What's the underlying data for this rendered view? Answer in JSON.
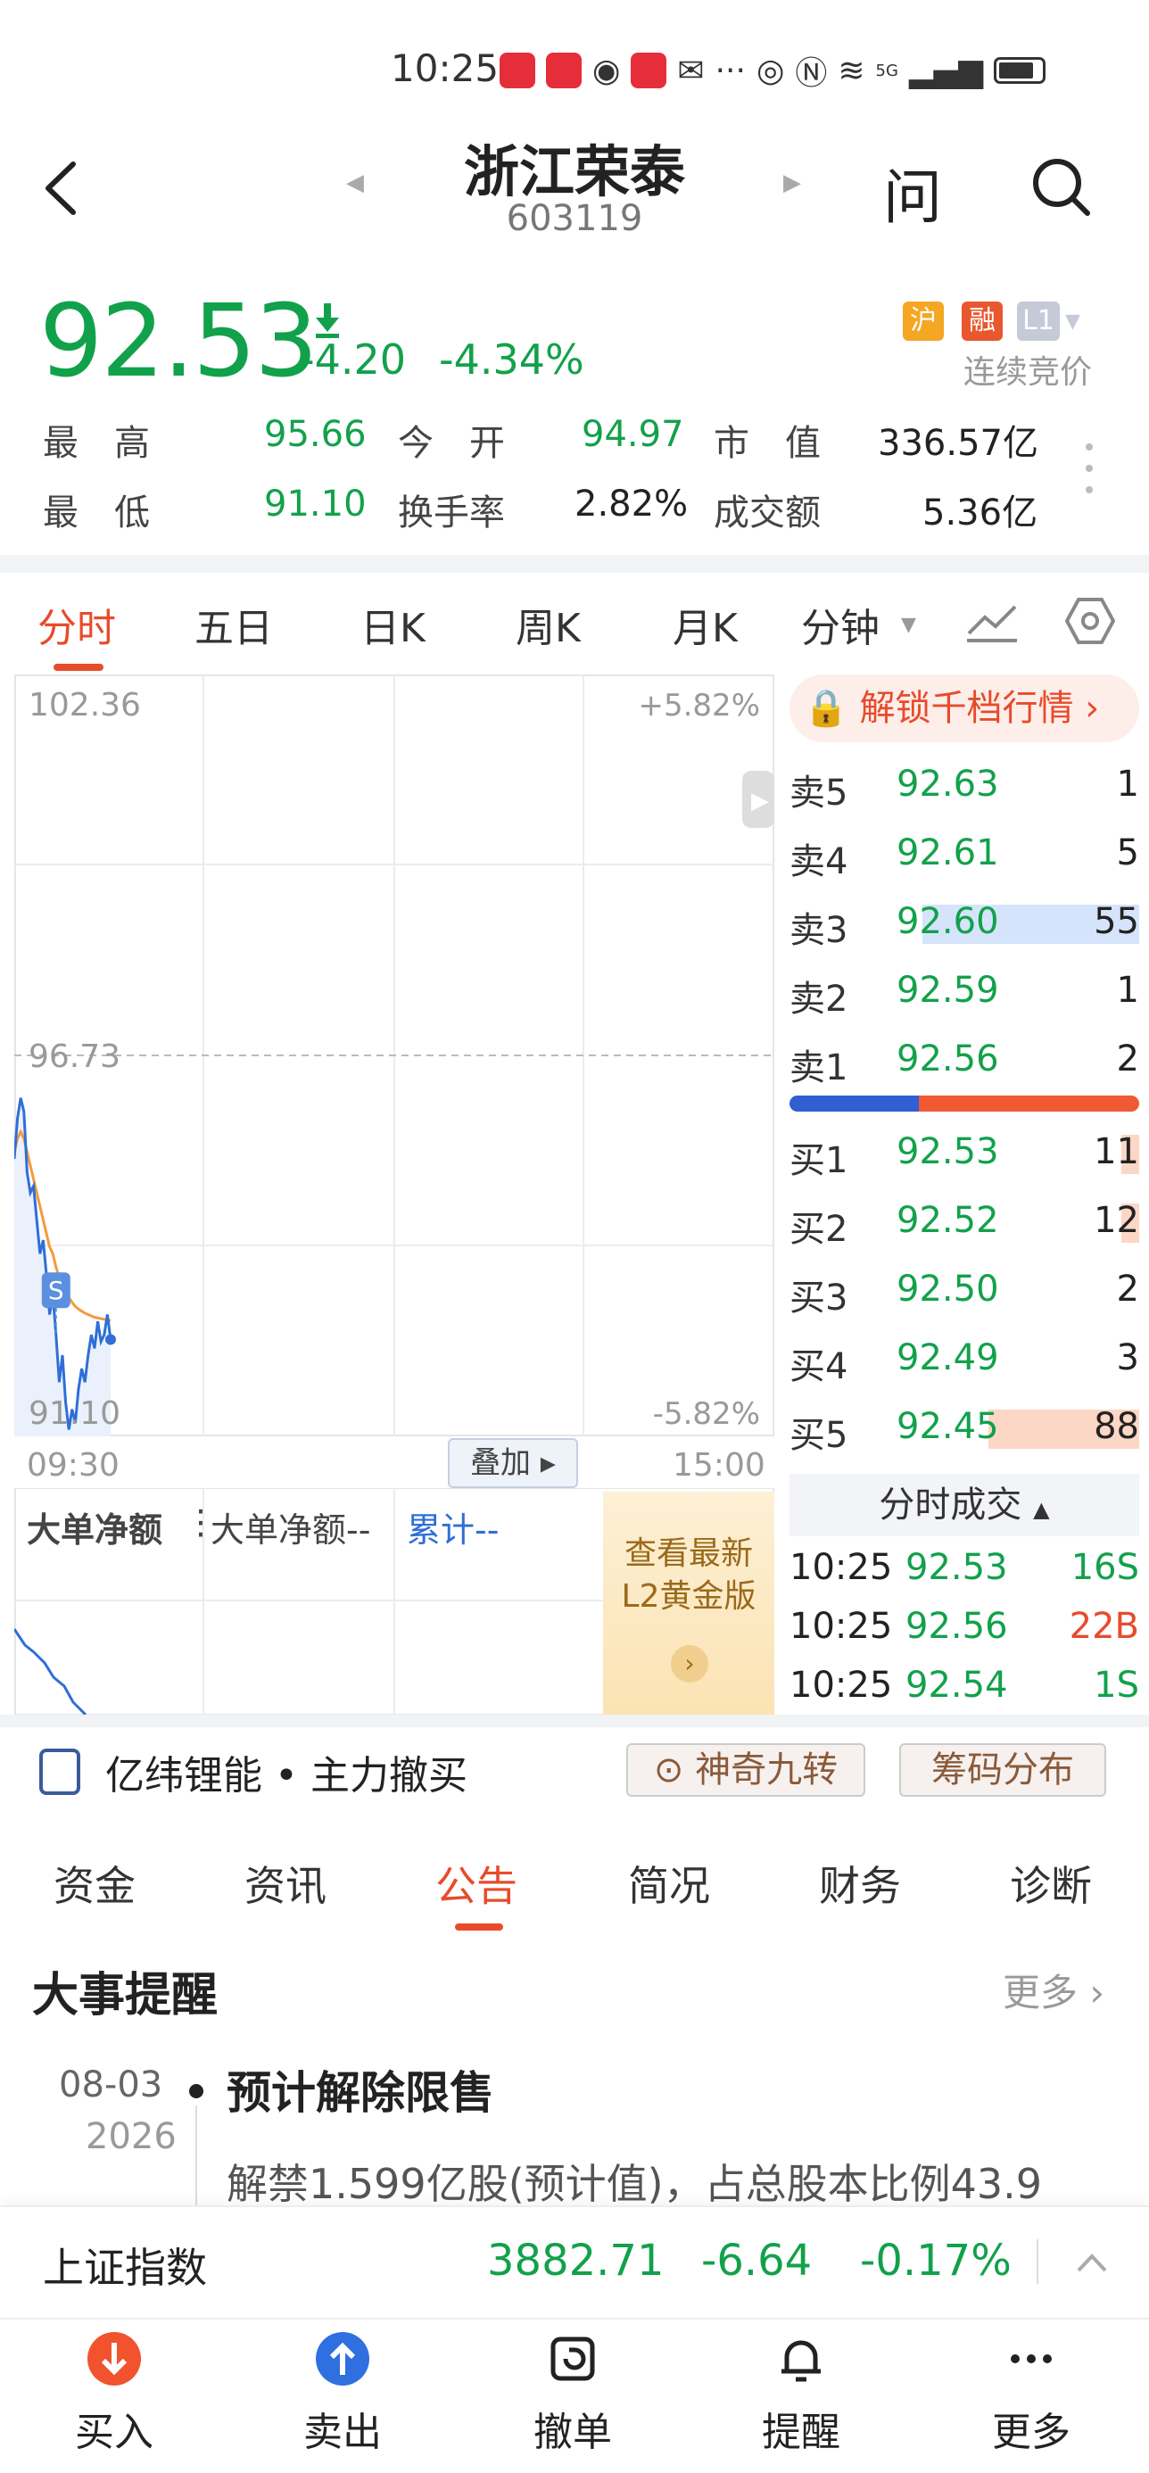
{
  "status_bar": {
    "time": "10:25",
    "network": "5G",
    "extra_dots": "···"
  },
  "header": {
    "title": "浙江荣泰",
    "code": "603119",
    "ask_label": "问"
  },
  "quote": {
    "price": "92.53",
    "change": "-4.20",
    "change_pct": "-4.34%",
    "badges": [
      "沪",
      "融",
      "L1"
    ],
    "auction_label": "连续竞价",
    "stats": [
      {
        "label": "最　高",
        "value": "95.66"
      },
      {
        "label": "今　开",
        "value": "94.97"
      },
      {
        "label": "市　值",
        "value": "336.57亿"
      },
      {
        "label": "最　低",
        "value": "91.10"
      },
      {
        "label": "换手率",
        "value": "2.82%"
      },
      {
        "label": "成交额",
        "value": "5.36亿"
      }
    ]
  },
  "period_tabs": [
    "分时",
    "五日",
    "日K",
    "周K",
    "月K",
    "分钟"
  ],
  "chart_data": {
    "type": "line",
    "y_top": "102.36",
    "y_mid": "96.73",
    "y_bottom": "91.10",
    "pct_top": "+5.82%",
    "pct_bottom": "-5.82%",
    "x_start": "09:30",
    "x_end": "15:00",
    "overlay_label": "叠加",
    "signal_marker": "S",
    "ylim": [
      91.1,
      102.36
    ],
    "price": [
      95.2,
      95.8,
      96.1,
      95.9,
      95.0,
      94.7,
      94.8,
      94.3,
      93.8,
      94.0,
      93.5,
      92.9,
      93.2,
      92.6,
      91.9,
      92.3,
      91.6,
      91.2,
      91.5,
      91.3,
      91.8,
      92.1,
      91.9,
      92.3,
      92.6,
      92.4,
      92.8,
      92.5,
      92.6,
      92.9,
      92.53
    ],
    "avg_price": [
      95.3,
      95.5,
      95.6,
      95.5,
      95.3,
      95.1,
      94.9,
      94.7,
      94.5,
      94.3,
      94.1,
      93.9,
      93.8,
      93.6,
      93.45,
      93.35,
      93.25,
      93.15,
      93.08,
      93.02,
      92.98,
      92.95,
      92.92,
      92.9,
      92.88,
      92.86,
      92.85,
      92.84,
      92.83,
      92.82,
      92.81
    ]
  },
  "volume_panel": {
    "title": "大单净额",
    "label": "大单净额--",
    "accum": "累计--"
  },
  "promo": {
    "line1": "查看最新",
    "line2": "L2黄金版"
  },
  "order_book": {
    "unlock_label": "解锁千档行情",
    "sells": [
      {
        "label": "卖5",
        "price": "92.63",
        "qty": "1",
        "bar": 0
      },
      {
        "label": "卖4",
        "price": "92.61",
        "qty": "5",
        "bar": 0
      },
      {
        "label": "卖3",
        "price": "92.60",
        "qty": "55",
        "bar": 0.62
      },
      {
        "label": "卖2",
        "price": "92.59",
        "qty": "1",
        "bar": 0
      },
      {
        "label": "卖1",
        "price": "92.56",
        "qty": "2",
        "bar": 0
      }
    ],
    "buys": [
      {
        "label": "买1",
        "price": "92.53",
        "qty": "11",
        "bar": 0.05
      },
      {
        "label": "买2",
        "price": "92.52",
        "qty": "12",
        "bar": 0.05
      },
      {
        "label": "买3",
        "price": "92.50",
        "qty": "2",
        "bar": 0
      },
      {
        "label": "买4",
        "price": "92.49",
        "qty": "3",
        "bar": 0
      },
      {
        "label": "买5",
        "price": "92.45",
        "qty": "88",
        "bar": 0.43
      }
    ],
    "buy_sell_ratio": 0.37
  },
  "trades": {
    "header": "分时成交",
    "rows": [
      {
        "time": "10:25",
        "price": "92.53",
        "vol": "16S",
        "side": "sell"
      },
      {
        "time": "10:25",
        "price": "92.56",
        "vol": "22B",
        "side": "buy"
      },
      {
        "time": "10:25",
        "price": "92.54",
        "vol": "1S",
        "side": "sell"
      }
    ]
  },
  "concept": {
    "name": "亿纬锂能",
    "dot": "•",
    "action": "主力撤买",
    "pill1": "神奇九转",
    "pill2": "筹码分布"
  },
  "info_tabs": [
    "资金",
    "资讯",
    "公告",
    "简况",
    "财务",
    "诊断"
  ],
  "events": {
    "title": "大事提醒",
    "more": "更多",
    "items": [
      {
        "date": "08-03",
        "year": "2026",
        "title": "预计解除限售",
        "desc": "解禁1.599亿股(预计值)，占总股本比例43.9"
      }
    ]
  },
  "index_bar": {
    "name": "上证指数",
    "value": "3882.71",
    "change": "-6.64",
    "pct": "-0.17%"
  },
  "bottom_nav": [
    "买入",
    "卖出",
    "撤单",
    "提醒",
    "更多"
  ],
  "colors": {
    "up": "#e84b2b",
    "down": "#12a14b",
    "accent": "#e84b2b"
  }
}
